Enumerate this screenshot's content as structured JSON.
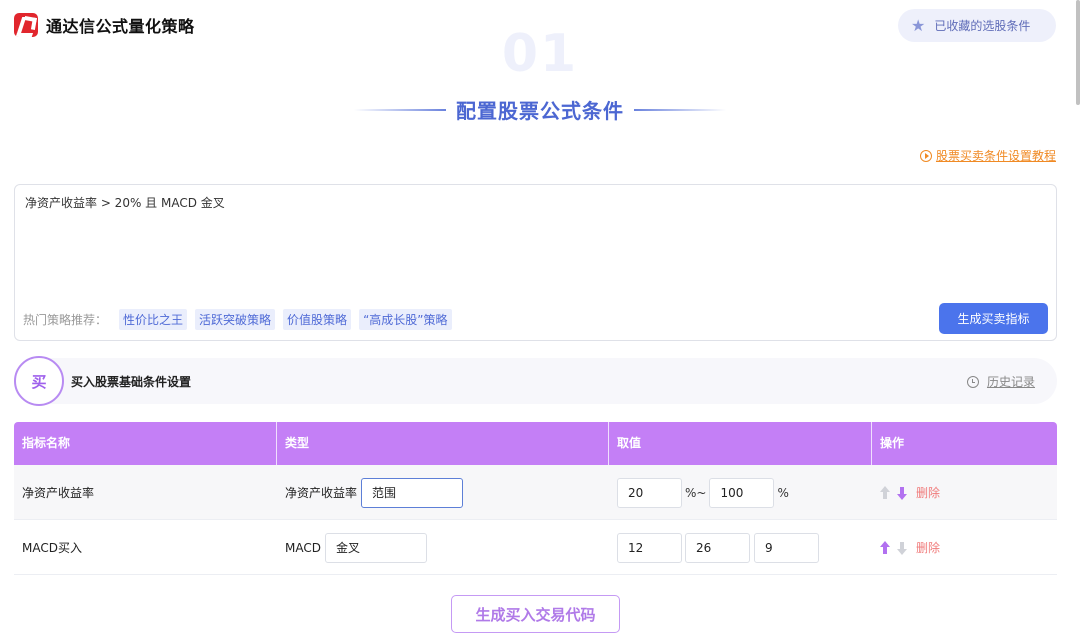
{
  "app": {
    "title": "通达信公式量化策略"
  },
  "favorites_button": {
    "label": "已收藏的选股条件",
    "icon": "star-icon"
  },
  "step": {
    "number": "01",
    "title": "配置股票公式条件"
  },
  "tutorial_link": {
    "label": "股票买卖条件设置教程",
    "icon": "play-circle-icon"
  },
  "condition": {
    "text": "净资产收益率 > 20% 且 MACD 金叉",
    "hot_label": "热门策略推荐：",
    "strategies": [
      "性价比之王",
      "活跃突破策略",
      "价值股策略",
      "“高成长股”策略"
    ],
    "generate_button": "生成买卖指标"
  },
  "buy_section": {
    "badge": "买",
    "title": "买入股票基础条件设置",
    "history_label": "历史记录",
    "history_icon": "clock-icon"
  },
  "table": {
    "headers": [
      "指标名称",
      "类型",
      "取值",
      "操作"
    ],
    "rows": [
      {
        "name": "净资产收益率",
        "type_label": "净资产收益率",
        "type_value": "范围",
        "values": [
          "20",
          "100"
        ],
        "units": [
          "%~",
          "%"
        ],
        "delete_label": "删除"
      },
      {
        "name": "MACD买入",
        "type_label": "MACD",
        "type_value": "金叉",
        "values": [
          "12",
          "26",
          "9"
        ],
        "delete_label": "删除"
      }
    ]
  },
  "generate_code_button": "生成买入交易代码",
  "colors": {
    "brand_red": "#e1262d",
    "accent_blue": "#4b74ec",
    "title_blue": "#4c67d2",
    "purple_header": "#c47ff6",
    "link_orange": "#f08a24",
    "delete_red": "#f07b7b"
  }
}
